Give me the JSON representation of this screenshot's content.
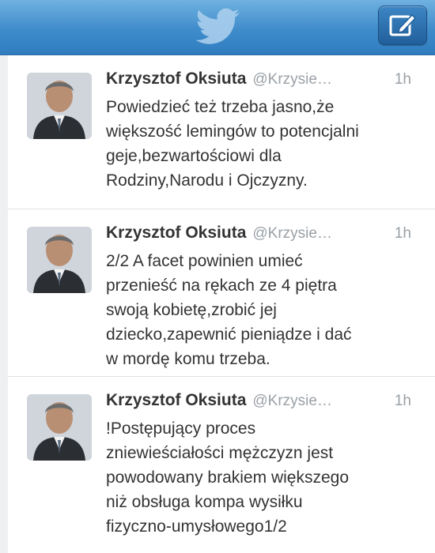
{
  "header": {
    "logo_icon": "twitter-bird-icon",
    "compose_icon": "compose-tweet-icon",
    "bar_color": "#3f8ccb"
  },
  "tweets": [
    {
      "name": "Krzysztof Oksiuta",
      "handle": "@Krzysie…",
      "time": "1h",
      "text": "Powiedzieć też trzeba jasno,że\nwiększość lemingów to potencjalni\ngeje,bezwartościowi dla\nRodziny,Narodu i Ojczyzny."
    },
    {
      "name": "Krzysztof Oksiuta",
      "handle": "@Krzysie…",
      "time": "1h",
      "text": "2/2 A facet powinien umieć\nprzenieść na rękach ze 4 piętra\nswoją kobietę,zrobić jej\ndziecko,zapewnić pieniądze i dać\nw mordę komu trzeba."
    },
    {
      "name": "Krzysztof Oksiuta",
      "handle": "@Krzysie…",
      "time": "1h",
      "text": "!Postępujący proces\nzniewieściałości mężczyzn jest\npowodowany brakiem większego\nniż obsługa kompa wysiłku\nfizyczno-umysłowego1/2"
    }
  ]
}
